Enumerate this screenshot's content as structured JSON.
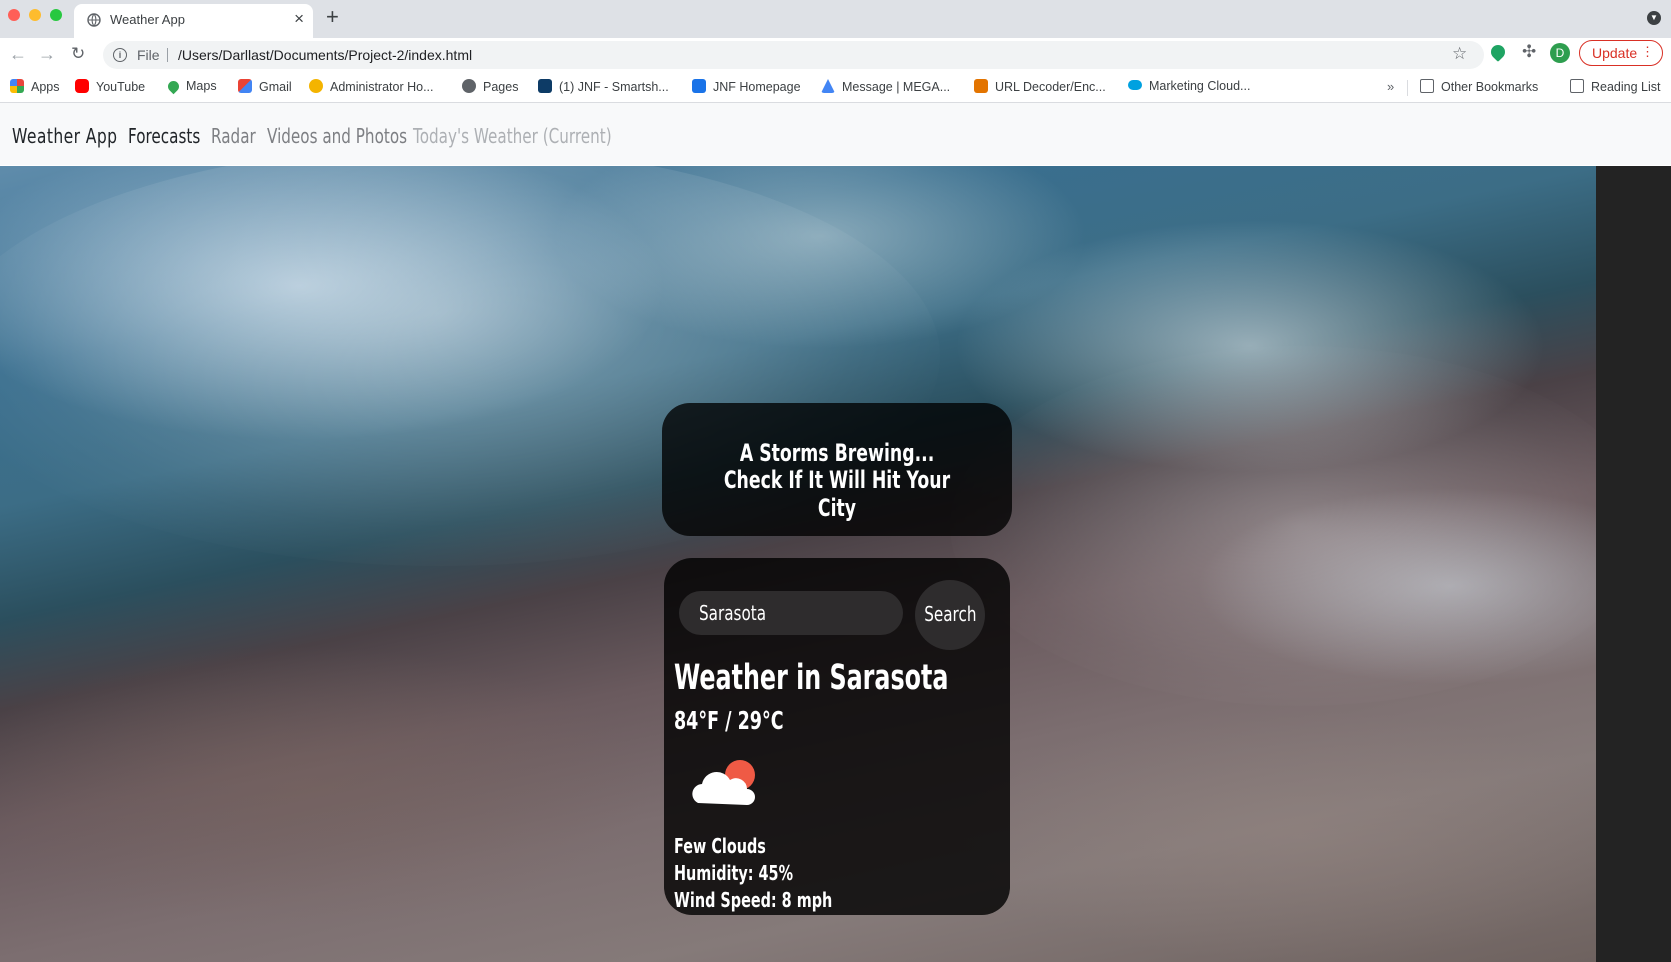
{
  "browser": {
    "tab_title": "Weather App",
    "tab_close": "×",
    "new_tab": "+",
    "scheme": "File",
    "url": "/Users/Darllast/Documents/Project-2/index.html",
    "profile_initial": "D",
    "update_label": "Update",
    "bookmarks": [
      {
        "label": "Apps",
        "icon": "apps-grid-icon",
        "color": "#e8453c"
      },
      {
        "label": "YouTube",
        "icon": "youtube-icon",
        "color": "#ff0000"
      },
      {
        "label": "Maps",
        "icon": "maps-pin-icon",
        "color": "#34a853"
      },
      {
        "label": "Gmail",
        "icon": "gmail-icon",
        "color": "#ea4335"
      },
      {
        "label": "Administrator Ho...",
        "icon": "admin-icon",
        "color": "#f4b400"
      },
      {
        "label": "Pages",
        "icon": "globe-icon",
        "color": "#5f6368"
      },
      {
        "label": "(1) JNF - Smartsh...",
        "icon": "smartsheet-icon",
        "color": "#0d3b66"
      },
      {
        "label": "JNF Homepage",
        "icon": "jnf-icon",
        "color": "#1a73e8"
      },
      {
        "label": "Message | MEGA...",
        "icon": "mega-icon",
        "color": "#4285f4"
      },
      {
        "label": "URL Decoder/Enc...",
        "icon": "url-decoder-icon",
        "color": "#e37400"
      },
      {
        "label": "Marketing Cloud...",
        "icon": "salesforce-cloud-icon",
        "color": "#00a1e0"
      }
    ],
    "overflow": "»",
    "other_bookmarks": "Other Bookmarks",
    "reading_list": "Reading List"
  },
  "navbar": {
    "brand": "Weather App",
    "links": [
      "Forecasts",
      "Radar",
      "Videos and Photos",
      "Today's Weather (Current)"
    ]
  },
  "banner": {
    "line1": "A Storms Brewing...",
    "line2": "Check If It Will Hit Your City"
  },
  "weather": {
    "search_value": "Sarasota",
    "search_button": "Search",
    "title": "Weather in Sarasota",
    "temperature": "84°F / 29°C",
    "icon": "few-clouds-sun-icon",
    "description": "Few Clouds",
    "humidity": "Humidity: 45%",
    "wind": "Wind Speed: 8 mph"
  },
  "colors": {
    "update_red": "#d93025",
    "card_bg": "rgba(0,0,0,0.8)",
    "sun": "#ef5a45",
    "cloud": "#ffffff"
  }
}
